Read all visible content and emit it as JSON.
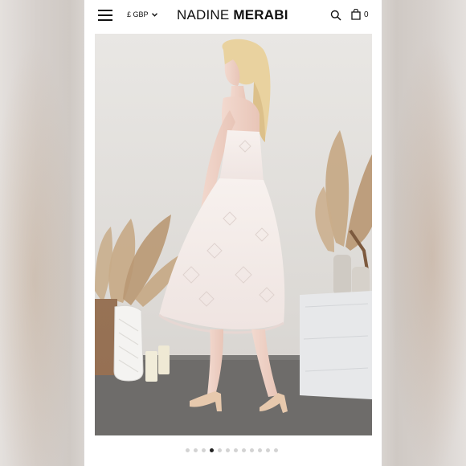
{
  "header": {
    "currency_label": "£ GBP",
    "brand_first": "NADINE",
    "brand_second": "MERABI",
    "cart_count": "0"
  },
  "icons": {
    "menu": "hamburger-icon",
    "currency_dropdown": "chevron-down-icon",
    "search": "search-icon",
    "cart": "shopping-bag-icon"
  },
  "gallery": {
    "total_images": 12,
    "active_index": 3
  },
  "colors": {
    "text": "#111111",
    "dot_inactive": "#d3d3d3",
    "dot_active": "#222222"
  }
}
